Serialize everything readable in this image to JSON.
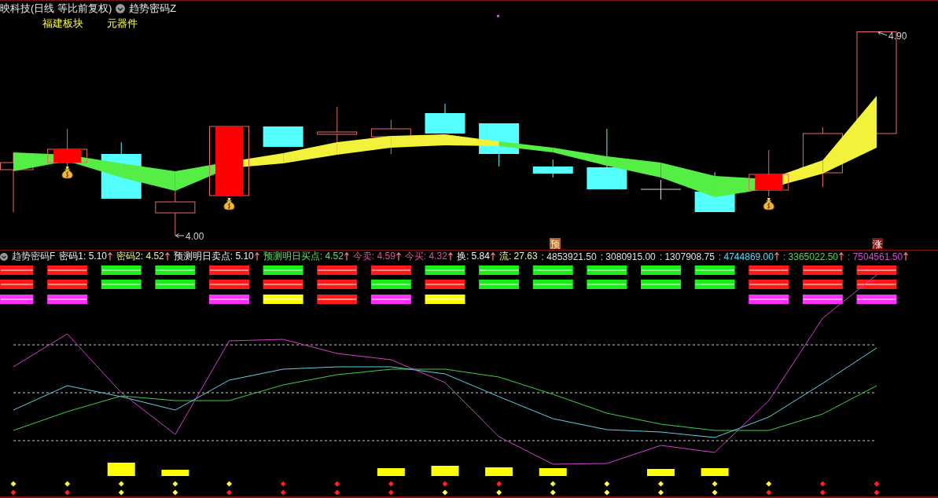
{
  "header": {
    "title": "映科技(日线 等比前复权)",
    "indicator": "趋势密码Z",
    "sectors": [
      "福建板块",
      "元器件"
    ]
  },
  "price_chart": {
    "price_labels": [
      {
        "kind": "low",
        "text": "4.00"
      },
      {
        "kind": "high",
        "text": "4.90"
      }
    ],
    "badges": [
      {
        "kind": "forecast",
        "text": "预"
      },
      {
        "kind": "rise",
        "text": "涨"
      }
    ]
  },
  "indicator_panel": {
    "name": "趋势密码F",
    "readings": [
      {
        "text": "密码1: 5.10",
        "color": "#f0f0f0",
        "arrow": true
      },
      {
        "text": "密码2: 4.52",
        "color": "#f0f080",
        "arrow": true
      },
      {
        "text": "预测明日卖点: 5.10",
        "color": "#f0f0f0",
        "arrow": true
      },
      {
        "text": "预测明日买点: 4.52",
        "color": "#60e060",
        "arrow": true
      },
      {
        "text": "今卖: 4.59",
        "color": "#e0509a",
        "arrow": true
      },
      {
        "text": "今买: 4.32",
        "color": "#e0509a",
        "arrow": true
      },
      {
        "text": "换: 5.84",
        "color": "#f0f0f0",
        "arrow": true
      },
      {
        "text": "流: 27.63",
        "color": "#f0f0a0",
        "arrow": false
      },
      {
        "text": ": 4853921.50",
        "color": "#e0e0e0",
        "arrow": false
      },
      {
        "text": ": 3080915.00",
        "color": "#e0e0e0",
        "arrow": false
      },
      {
        "text": ": 1307908.75",
        "color": "#e0e0e0",
        "arrow": false
      },
      {
        "text": ": 4744869.00",
        "color": "#60d8f0",
        "arrow": true
      },
      {
        "text": ": 3365022.50",
        "color": "#60d060",
        "arrow": true
      },
      {
        "text": ": 7504561.50",
        "color": "#d050d0",
        "arrow": true
      }
    ],
    "signal_rows": [
      {
        "cells": [
          {
            "kind": "bar",
            "color": "#ff1a1a"
          },
          {
            "kind": "bar",
            "color": "#ff1a1a"
          },
          {
            "kind": "bar",
            "color": "#1aee1a"
          },
          {
            "kind": "bar",
            "color": "#1aee1a"
          },
          {
            "kind": "bar",
            "color": "#ff1a1a"
          },
          {
            "kind": "bar",
            "color": "#1aee1a"
          },
          {
            "kind": "bar",
            "color": "#ff1a1a"
          },
          {
            "kind": "bar",
            "color": "#ff1a1a"
          },
          {
            "kind": "bar",
            "color": "#1aee1a"
          },
          {
            "kind": "bar",
            "color": "#1aee1a"
          },
          {
            "kind": "bar",
            "color": "#1aee1a"
          },
          {
            "kind": "bar",
            "color": "#1aee1a"
          },
          {
            "kind": "bar",
            "color": "#1aee1a"
          },
          {
            "kind": "bar",
            "color": "#1aee1a"
          },
          {
            "kind": "bar",
            "color": "#ff1a1a"
          },
          {
            "kind": "bar",
            "color": "#ff1a1a"
          },
          {
            "kind": "bar",
            "color": "#ff1a1a"
          }
        ]
      },
      {
        "cells": [
          {
            "kind": "bar",
            "color": "#ff1a1a"
          },
          {
            "kind": "bar",
            "color": "#ff1a1a"
          },
          {
            "kind": "bar",
            "color": "#1aee1a"
          },
          {
            "kind": "bar",
            "color": "#1aee1a"
          },
          {
            "kind": "bar",
            "color": "#ff1a1a"
          },
          {
            "kind": "bar",
            "color": "#ff1a1a"
          },
          {
            "kind": "bar",
            "color": "#ff1a1a"
          },
          {
            "kind": "bar",
            "color": "#1aee1a"
          },
          {
            "kind": "bar",
            "color": "#ff1a1a"
          },
          {
            "kind": "bar",
            "color": "#1aee1a"
          },
          {
            "kind": "bar",
            "color": "#1aee1a"
          },
          {
            "kind": "bar",
            "color": "#1aee1a"
          },
          {
            "kind": "bar",
            "color": "#1aee1a"
          },
          {
            "kind": "bar",
            "color": "#1aee1a"
          },
          {
            "kind": "bar",
            "color": "#ff1a1a"
          },
          {
            "kind": "bar",
            "color": "#ff1a1a"
          },
          {
            "kind": "bar",
            "color": "#ff1a1a"
          }
        ]
      },
      {
        "cells": [
          {
            "kind": "bar",
            "color": "#ff30ff"
          },
          {
            "kind": "bar",
            "color": "#ff30ff"
          },
          {
            "kind": "blank"
          },
          {
            "kind": "blank"
          },
          {
            "kind": "bar",
            "color": "#ff30ff"
          },
          {
            "kind": "bar",
            "color": "#ffff00"
          },
          {
            "kind": "bar",
            "color": "#ff1a1a"
          },
          {
            "kind": "bar",
            "color": "#ff30ff"
          },
          {
            "kind": "bar",
            "color": "#ffff00"
          },
          {
            "kind": "blank"
          },
          {
            "kind": "blank"
          },
          {
            "kind": "blank"
          },
          {
            "kind": "blank"
          },
          {
            "kind": "blank"
          },
          {
            "kind": "bar",
            "color": "#ff30ff"
          },
          {
            "kind": "bar",
            "color": "#ff30ff"
          },
          {
            "kind": "bar",
            "color": "#ff30ff"
          }
        ]
      }
    ],
    "marker_rows": [
      {
        "markers": [
          {
            "color": "#ffff40"
          },
          {
            "color": "#ffff40"
          },
          {
            "color": "#ffff40"
          },
          {
            "color": "#ffff40"
          },
          {
            "color": "#ffff40"
          },
          {
            "color": "#ff2020"
          },
          {
            "color": "#ff2020"
          },
          {
            "color": "#ff2020"
          },
          {
            "color": "#ff2020"
          },
          {
            "color": "#ff2020"
          },
          {
            "color": "#ffff40"
          },
          {
            "color": "#ffff40"
          },
          {
            "color": "#ffff40"
          },
          {
            "color": "#ffff40"
          },
          {
            "color": "#ffff40"
          },
          {
            "color": "#ff2020"
          },
          {
            "color": "#ff2020"
          }
        ]
      },
      {
        "markers": [
          {
            "color": "#ff2020"
          },
          {
            "color": "#ff2020"
          },
          {
            "color": "#ffff40"
          },
          {
            "color": "#ffff40"
          },
          {
            "color": "#ff2020"
          },
          {
            "color": "#ff2020"
          },
          {
            "color": "#ff2020"
          },
          {
            "color": "#ff2020"
          },
          {
            "color": "#ffff40"
          },
          {
            "color": "#ffff40"
          },
          {
            "color": "#ffff40"
          },
          {
            "color": "#ffff40"
          },
          {
            "color": "#ffff40"
          },
          {
            "color": "#ffff40"
          },
          {
            "color": "#ff2020"
          },
          {
            "color": "#ff2020"
          },
          {
            "color": "#ff2020"
          }
        ]
      }
    ]
  }
}
